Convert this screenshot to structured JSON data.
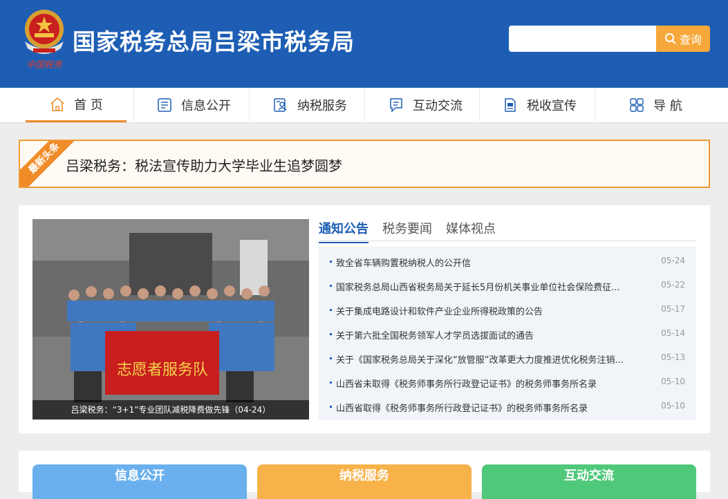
{
  "header": {
    "site_title": "国家税务总局吕梁市税务局",
    "emblem_caption": "中国税务",
    "search": {
      "placeholder": "",
      "button_label": "查询"
    }
  },
  "nav": {
    "items": [
      {
        "label": "首 页",
        "icon": "home-icon",
        "active": true
      },
      {
        "label": "信息公开",
        "icon": "info-doc-icon"
      },
      {
        "label": "纳税服务",
        "icon": "service-icon"
      },
      {
        "label": "互动交流",
        "icon": "chat-icon"
      },
      {
        "label": "税收宣传",
        "icon": "publicity-icon"
      },
      {
        "label": "导 航",
        "icon": "grid-icon"
      }
    ]
  },
  "headline": {
    "badge": "最新头条",
    "text": "吕梁税务：税法宣传助力大学毕业生追梦圆梦"
  },
  "main": {
    "photo_caption": "吕梁税务：“3+1”专业团队减税降费做先锋（04-24）",
    "photo_banner_text": "志愿者服务队",
    "tabs": [
      {
        "label": "通知公告",
        "active": true
      },
      {
        "label": "税务要闻"
      },
      {
        "label": "媒体视点"
      }
    ],
    "news": [
      {
        "title": "致全省车辆购置税纳税人的公开信",
        "date": "05-24"
      },
      {
        "title": "国家税务总局山西省税务局关于延长5月份机关事业单位社会保险费征...",
        "date": "05-22"
      },
      {
        "title": "关于集成电路设计和软件产业企业所得税政策的公告",
        "date": "05-17"
      },
      {
        "title": "关于第六批全国税务领军人才学员选拔面试的通告",
        "date": "05-14"
      },
      {
        "title": "关于《国家税务总局关于深化“放管服”改革更大力度推进优化税务注销...",
        "date": "05-13"
      },
      {
        "title": "山西省未取得《税务师事务所行政登记证书》的税务师事务所名录",
        "date": "05-10"
      },
      {
        "title": "山西省取得《税务师事务所行政登记证书》的税务师事务所名录",
        "date": "05-10"
      }
    ]
  },
  "bottom": {
    "buttons": [
      {
        "label": "信息公开",
        "color": "#6ab0ee"
      },
      {
        "label": "纳税服务",
        "color": "#f7b24a"
      },
      {
        "label": "互动交流",
        "color": "#4fc87a"
      }
    ]
  },
  "colors": {
    "brand": "#1d5eb4",
    "accent": "#f08c28",
    "search_button": "#f7a83a"
  }
}
